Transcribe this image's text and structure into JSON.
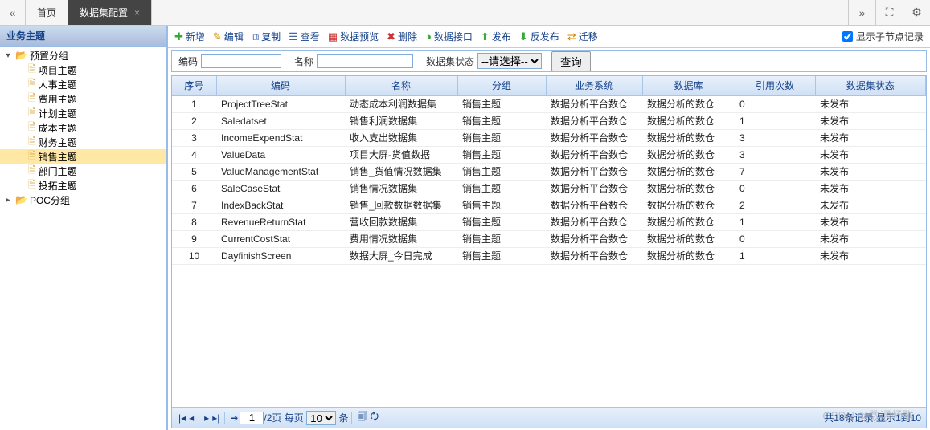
{
  "tabs": {
    "home": "首页",
    "active": "数据集配置"
  },
  "sidebar": {
    "title": "业务主题",
    "nodes": [
      {
        "label": "预置分组",
        "type": "folder",
        "indent": 0,
        "expanded": true
      },
      {
        "label": "项目主题",
        "type": "file",
        "indent": 1
      },
      {
        "label": "人事主题",
        "type": "file",
        "indent": 1
      },
      {
        "label": "费用主题",
        "type": "file",
        "indent": 1
      },
      {
        "label": "计划主题",
        "type": "file",
        "indent": 1
      },
      {
        "label": "成本主题",
        "type": "file",
        "indent": 1
      },
      {
        "label": "财务主题",
        "type": "file",
        "indent": 1
      },
      {
        "label": "销售主题",
        "type": "file",
        "indent": 1,
        "selected": true
      },
      {
        "label": "部门主题",
        "type": "file",
        "indent": 1
      },
      {
        "label": "投拓主题",
        "type": "file",
        "indent": 1
      },
      {
        "label": "POC分组",
        "type": "folder",
        "indent": 0,
        "expanded": false
      }
    ]
  },
  "toolbar": {
    "add": "新增",
    "edit": "编辑",
    "copy": "复制",
    "view": "查看",
    "preview": "数据预览",
    "delete": "删除",
    "api": "数据接口",
    "publish": "发布",
    "unpublish": "反发布",
    "move": "迁移",
    "showChildLabel": "显示子节点记录"
  },
  "filter": {
    "codeLabel": "编码",
    "codeValue": "",
    "nameLabel": "名称",
    "nameValue": "",
    "stateLabel": "数据集状态",
    "statePlaceholder": "--请选择--",
    "queryBtn": "查询"
  },
  "columns": {
    "seq": "序号",
    "code": "编码",
    "name": "名称",
    "group": "分组",
    "biz": "业务系统",
    "db": "数据库",
    "ref": "引用次数",
    "state": "数据集状态"
  },
  "rows": [
    {
      "seq": "1",
      "code": "ProjectTreeStat",
      "name": "动态成本利润数据集",
      "group": "销售主题",
      "biz": "数据分析平台数仓",
      "db": "数据分析的数仓",
      "ref": "0",
      "state": "未发布"
    },
    {
      "seq": "2",
      "code": "Saledatset",
      "name": "销售利润数据集",
      "group": "销售主题",
      "biz": "数据分析平台数仓",
      "db": "数据分析的数仓",
      "ref": "1",
      "state": "未发布"
    },
    {
      "seq": "3",
      "code": "IncomeExpendStat",
      "name": "收入支出数据集",
      "group": "销售主题",
      "biz": "数据分析平台数仓",
      "db": "数据分析的数仓",
      "ref": "3",
      "state": "未发布"
    },
    {
      "seq": "4",
      "code": "ValueData",
      "name": "项目大屏-货值数据",
      "group": "销售主题",
      "biz": "数据分析平台数仓",
      "db": "数据分析的数仓",
      "ref": "3",
      "state": "未发布"
    },
    {
      "seq": "5",
      "code": "ValueManagementStat",
      "name": "销售_货值情况数据集",
      "group": "销售主题",
      "biz": "数据分析平台数仓",
      "db": "数据分析的数仓",
      "ref": "7",
      "state": "未发布"
    },
    {
      "seq": "6",
      "code": "SaleCaseStat",
      "name": "销售情况数据集",
      "group": "销售主题",
      "biz": "数据分析平台数仓",
      "db": "数据分析的数仓",
      "ref": "0",
      "state": "未发布"
    },
    {
      "seq": "7",
      "code": "IndexBackStat",
      "name": "销售_回款数据数据集",
      "group": "销售主题",
      "biz": "数据分析平台数仓",
      "db": "数据分析的数仓",
      "ref": "2",
      "state": "未发布"
    },
    {
      "seq": "8",
      "code": "RevenueReturnStat",
      "name": "营收回款数据集",
      "group": "销售主题",
      "biz": "数据分析平台数仓",
      "db": "数据分析的数仓",
      "ref": "1",
      "state": "未发布"
    },
    {
      "seq": "9",
      "code": "CurrentCostStat",
      "name": "费用情况数据集",
      "group": "销售主题",
      "biz": "数据分析平台数仓",
      "db": "数据分析的数仓",
      "ref": "0",
      "state": "未发布"
    },
    {
      "seq": "10",
      "code": "DayfinishScreen",
      "name": "数据大屏_今日完成",
      "group": "销售主题",
      "biz": "数据分析平台数仓",
      "db": "数据分析的数仓",
      "ref": "1",
      "state": "未发布"
    }
  ],
  "pager": {
    "page": "1",
    "totalPagesSuffix": "/2页",
    "perPageLabel": "每页",
    "perPageValue": "10",
    "perPageUnit": "条",
    "summary": "共18条记录,显示1到10"
  },
  "watermark": "CSDN @数通畅联"
}
